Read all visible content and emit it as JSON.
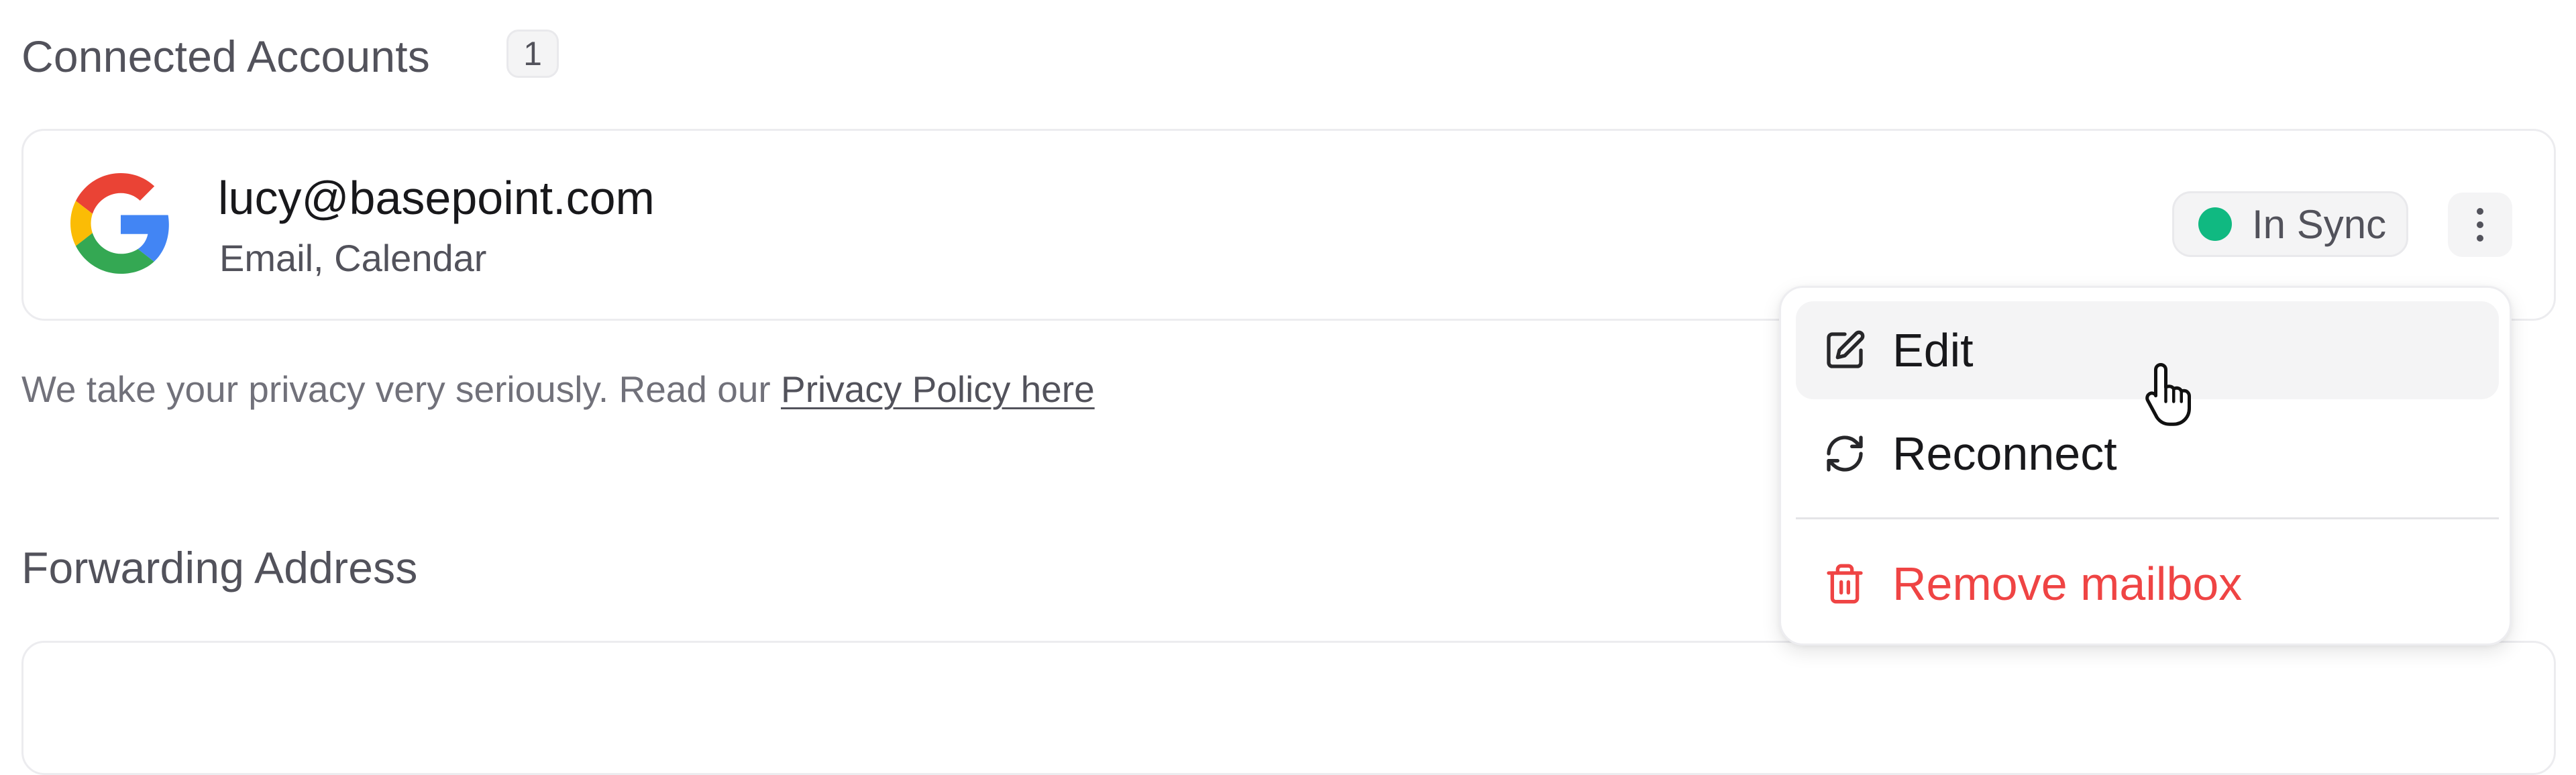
{
  "connected_accounts": {
    "title": "Connected Accounts",
    "count": "1",
    "accounts": [
      {
        "provider_icon": "google-logo",
        "email": "lucy@basepoint.com",
        "services": "Email, Calendar",
        "status": "In Sync",
        "status_color": "#10b981"
      }
    ]
  },
  "privacy": {
    "text": "We take your privacy very seriously. Read our ",
    "link_label": "Privacy Policy here"
  },
  "forwarding": {
    "title": "Forwarding Address"
  },
  "account_menu": {
    "items": [
      {
        "label": "Edit",
        "icon": "edit-icon"
      },
      {
        "label": "Reconnect",
        "icon": "refresh-icon"
      },
      {
        "label": "Remove mailbox",
        "icon": "trash-icon",
        "color": "#ef4444"
      }
    ]
  },
  "colors": {
    "accent_danger": "#ef4444",
    "status_green": "#10b981",
    "muted_text": "#52525b"
  }
}
